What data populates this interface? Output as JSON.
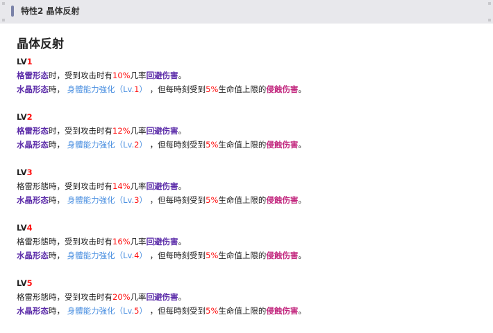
{
  "header": {
    "title": "特性2 晶体反射"
  },
  "main_title": "晶体反射",
  "colors": {
    "purple": "#5a2aa8",
    "blue": "#4a8fe0",
    "red": "#ff1010",
    "pink": "#c2277e"
  },
  "levels": [
    {
      "label": "LV",
      "num": "1",
      "lines": [
        [
          {
            "t": "格雷形态",
            "s": "purple"
          },
          {
            "t": "时，受到攻击时有"
          },
          {
            "t": "10%",
            "s": "red"
          },
          {
            "t": "几率"
          },
          {
            "t": "回避伤害",
            "s": "purple"
          },
          {
            "t": "。"
          }
        ],
        [
          {
            "t": "水晶形态",
            "s": "purple"
          },
          {
            "t": "時， "
          },
          {
            "t": "身體能力強化（Lv.",
            "s": "blue"
          },
          {
            "t": "1",
            "s": "red"
          },
          {
            "t": "）",
            "s": "blue"
          },
          {
            "t": " ，但每時刻受到"
          },
          {
            "t": "5%",
            "s": "red"
          },
          {
            "t": "生命值上限的"
          },
          {
            "t": "侵蝕伤害",
            "s": "pink"
          },
          {
            "t": "。"
          }
        ]
      ]
    },
    {
      "label": "LV",
      "num": "2",
      "lines": [
        [
          {
            "t": "格雷形态",
            "s": "purple"
          },
          {
            "t": "时，受到攻击时有"
          },
          {
            "t": "12%",
            "s": "red"
          },
          {
            "t": "几率"
          },
          {
            "t": "回避伤害",
            "s": "purple"
          },
          {
            "t": "。"
          }
        ],
        [
          {
            "t": "水晶形态",
            "s": "purple"
          },
          {
            "t": "時， "
          },
          {
            "t": "身體能力強化（Lv.",
            "s": "blue"
          },
          {
            "t": "2",
            "s": "red"
          },
          {
            "t": "）",
            "s": "blue"
          },
          {
            "t": " ，但每時刻受到"
          },
          {
            "t": "5%",
            "s": "red"
          },
          {
            "t": "生命值上限的"
          },
          {
            "t": "侵蝕伤害",
            "s": "pink"
          },
          {
            "t": "。"
          }
        ]
      ]
    },
    {
      "label": "LV",
      "num": "3",
      "lines": [
        [
          {
            "t": "格雷形態時，受到攻击时有"
          },
          {
            "t": "14%",
            "s": "red"
          },
          {
            "t": "几率"
          },
          {
            "t": "回避伤害",
            "s": "purple"
          },
          {
            "t": "。"
          }
        ],
        [
          {
            "t": "水晶形态",
            "s": "purple"
          },
          {
            "t": "時， "
          },
          {
            "t": "身體能力強化（Lv.",
            "s": "blue"
          },
          {
            "t": "3",
            "s": "red"
          },
          {
            "t": "）",
            "s": "blue"
          },
          {
            "t": " ，但每時刻受到"
          },
          {
            "t": "5%",
            "s": "red"
          },
          {
            "t": "生命值上限的"
          },
          {
            "t": "侵蝕伤害",
            "s": "pink"
          },
          {
            "t": "。"
          }
        ]
      ]
    },
    {
      "label": "LV",
      "num": "4",
      "lines": [
        [
          {
            "t": "格雷形態時，受到攻击时有"
          },
          {
            "t": "16%",
            "s": "red"
          },
          {
            "t": "几率"
          },
          {
            "t": "回避伤害",
            "s": "purple"
          },
          {
            "t": "。"
          }
        ],
        [
          {
            "t": "水晶形态",
            "s": "purple"
          },
          {
            "t": "時， "
          },
          {
            "t": "身體能力強化（Lv.",
            "s": "blue"
          },
          {
            "t": "4",
            "s": "red"
          },
          {
            "t": "）",
            "s": "blue"
          },
          {
            "t": " ，但每時刻受到"
          },
          {
            "t": "5%",
            "s": "red"
          },
          {
            "t": "生命值上限的"
          },
          {
            "t": "侵蝕伤害",
            "s": "pink"
          },
          {
            "t": "。"
          }
        ]
      ]
    },
    {
      "label": "LV",
      "num": "5",
      "lines": [
        [
          {
            "t": "格雷形態時，受到攻击时有"
          },
          {
            "t": "20%",
            "s": "red"
          },
          {
            "t": "几率"
          },
          {
            "t": "回避伤害",
            "s": "purple"
          },
          {
            "t": "。"
          }
        ],
        [
          {
            "t": "水晶形态",
            "s": "purple"
          },
          {
            "t": "時， "
          },
          {
            "t": "身體能力強化（Lv.",
            "s": "blue"
          },
          {
            "t": "5",
            "s": "red"
          },
          {
            "t": "）",
            "s": "blue"
          },
          {
            "t": " ，但每時刻受到"
          },
          {
            "t": "5%",
            "s": "red"
          },
          {
            "t": "生命值上限的"
          },
          {
            "t": "侵蝕伤害",
            "s": "pink"
          },
          {
            "t": "。"
          }
        ]
      ]
    }
  ]
}
